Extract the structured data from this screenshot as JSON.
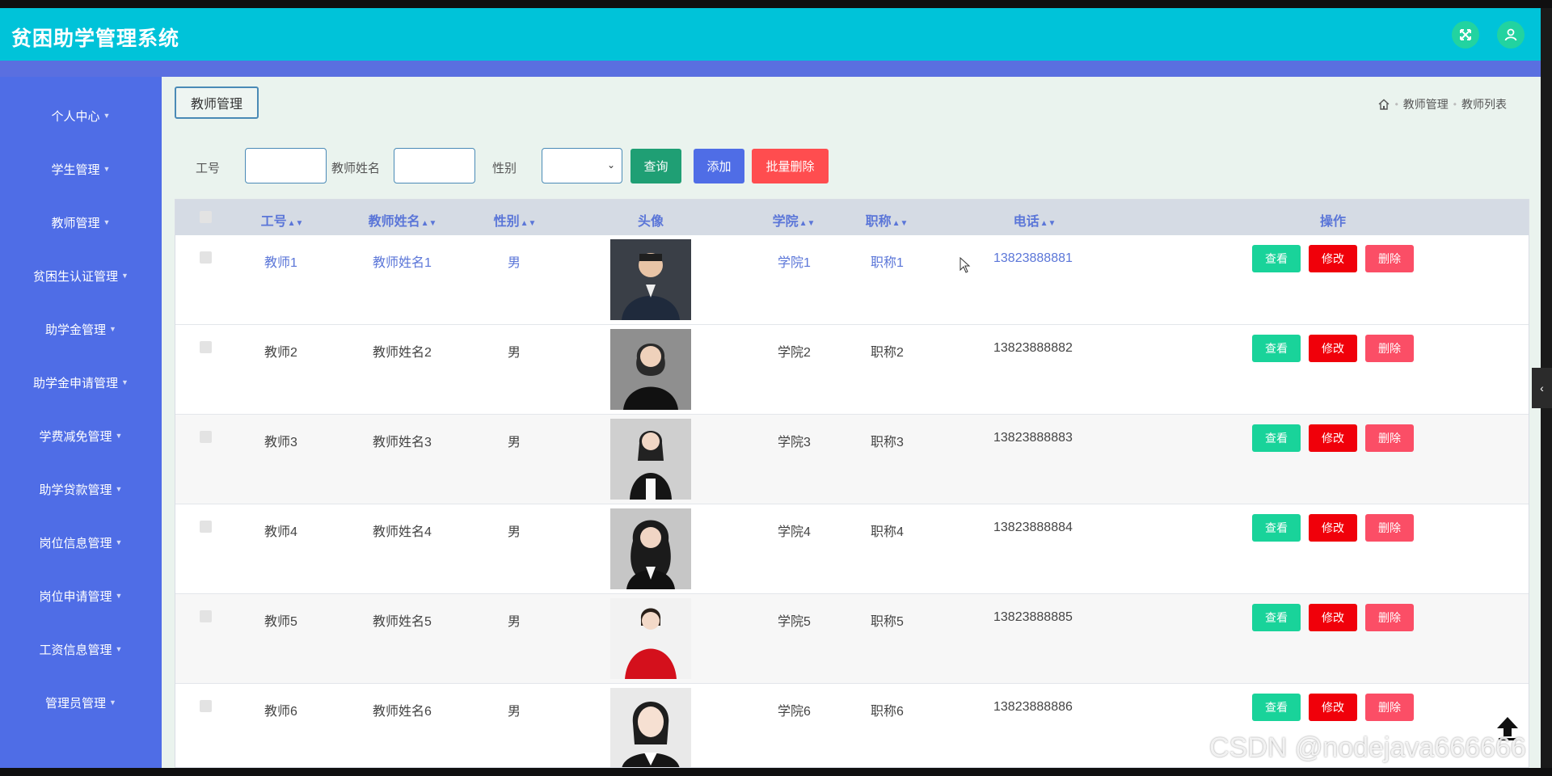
{
  "app": {
    "title": "贫困助学管理系统"
  },
  "header": {
    "fullscreen_icon": "fullscreen-icon",
    "user_icon": "user-icon"
  },
  "sidebar": {
    "items": [
      {
        "label": "个人中心"
      },
      {
        "label": "学生管理"
      },
      {
        "label": "教师管理"
      },
      {
        "label": "贫困生认证管理"
      },
      {
        "label": "助学金管理"
      },
      {
        "label": "助学金申请管理"
      },
      {
        "label": "学费减免管理"
      },
      {
        "label": "助学贷款管理"
      },
      {
        "label": "岗位信息管理"
      },
      {
        "label": "岗位申请管理"
      },
      {
        "label": "工资信息管理"
      },
      {
        "label": "管理员管理"
      }
    ]
  },
  "page": {
    "title": "教师管理",
    "breadcrumb": [
      "教师管理",
      "教师列表"
    ]
  },
  "search": {
    "id_label": "工号",
    "name_label": "教师姓名",
    "gender_label": "性别",
    "id_value": "",
    "name_value": "",
    "gender_selected": "",
    "query_label": "查询",
    "add_label": "添加",
    "batch_delete_label": "批量删除"
  },
  "table": {
    "headers": {
      "id": "工号",
      "name": "教师姓名",
      "gender": "性别",
      "avatar": "头像",
      "college": "学院",
      "title": "职称",
      "phone": "电话",
      "actions": "操作"
    },
    "rows": [
      {
        "id": "教师1",
        "name": "教师姓名1",
        "gender": "男",
        "college": "学院1",
        "title": "职称1",
        "phone": "13823888881"
      },
      {
        "id": "教师2",
        "name": "教师姓名2",
        "gender": "男",
        "college": "学院2",
        "title": "职称2",
        "phone": "13823888882"
      },
      {
        "id": "教师3",
        "name": "教师姓名3",
        "gender": "男",
        "college": "学院3",
        "title": "职称3",
        "phone": "13823888883"
      },
      {
        "id": "教师4",
        "name": "教师姓名4",
        "gender": "男",
        "college": "学院4",
        "title": "职称4",
        "phone": "13823888884"
      },
      {
        "id": "教师5",
        "name": "教师姓名5",
        "gender": "男",
        "college": "学院5",
        "title": "职称5",
        "phone": "13823888885"
      },
      {
        "id": "教师6",
        "name": "教师姓名6",
        "gender": "男",
        "college": "学院6",
        "title": "职称6",
        "phone": "13823888886"
      }
    ],
    "actions": {
      "view": "查看",
      "edit": "修改",
      "delete": "删除"
    }
  },
  "watermark": "CSDN @nodejava666666",
  "colors": {
    "header": "#00c3d9",
    "sidebar": "#4f6de6",
    "accent": "#5b76d8",
    "query_button": "#1f9f74",
    "add_button": "#4f6de6",
    "delete_button": "#ff4d4f",
    "view_button": "#19d39a",
    "edit_button": "#f0000a",
    "row_delete_button": "#fb4e66"
  }
}
